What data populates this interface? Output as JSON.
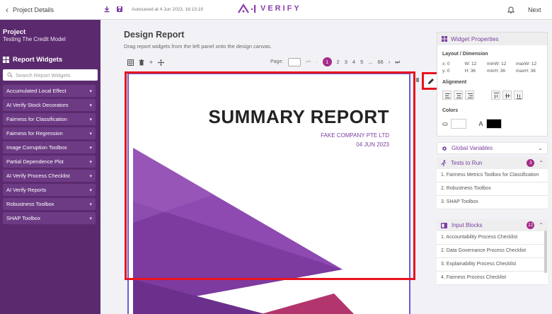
{
  "topbar": {
    "back_label": "Project Details",
    "autosave": "Autosaved at 4 Jun 2023, 16:13:19",
    "logo_text": "VERIFY",
    "next_label": "Next"
  },
  "sidebar": {
    "section_label": "Project",
    "project_name": "Testing The Credit Model",
    "widgets_title": "Report Widgets",
    "search_placeholder": "Search Report Widgets",
    "items": [
      {
        "label": "Accumulated Local Effect"
      },
      {
        "label": "AI Verify Stock Decorators"
      },
      {
        "label": "Fairness for Classification"
      },
      {
        "label": "Fairness for Regression"
      },
      {
        "label": "Image Corruption Toolbox"
      },
      {
        "label": "Partial Dependence Plot"
      },
      {
        "label": "AI Verify Process Checklist"
      },
      {
        "label": "AI Verify Reports"
      },
      {
        "label": "Robustness Toolbox"
      },
      {
        "label": "SHAP Toolbox"
      }
    ]
  },
  "main": {
    "title": "Design Report",
    "subtitle": "Drag report widgets from the left panel onto the design canvas.",
    "page_label": "Page:",
    "pages": [
      "1",
      "2",
      "3",
      "4",
      "5",
      "...",
      "66"
    ]
  },
  "canvas": {
    "report_title": "SUMMARY REPORT",
    "company": "FAKE COMPANY PTE LTD",
    "date": "04 JUN 2023"
  },
  "properties": {
    "title": "Widget Properties",
    "layout_label": "Layout / Dimension",
    "x": "x: 0",
    "y": "y: 0",
    "w": "W: 12",
    "h": "H: 36",
    "minw": "minW: 12",
    "minh": "minH: 36",
    "maxw": "maxW: 12",
    "maxh": "maxH: 36",
    "alignment_label": "Alignment",
    "colors_label": "Colors"
  },
  "global_variables": {
    "title": "Global Variables"
  },
  "tests": {
    "title": "Tests to Run",
    "count": "3",
    "items": [
      "1.  Fairness Metrics Toolbox for Classification",
      "2.  Robustness Toolbox",
      "3.  SHAP Toolbox"
    ]
  },
  "inputs": {
    "title": "Input Blocks",
    "count": "12",
    "items": [
      "1.  Accountability Process Checklist",
      "2.  Data Governance Process Checklist",
      "3.  Explainability Process Checklist",
      "4.  Fairness Process Checklist"
    ]
  },
  "colors": {
    "accent": "#a62a89",
    "sidebar": "#5b2a6e",
    "highlight": "#e8141d"
  }
}
